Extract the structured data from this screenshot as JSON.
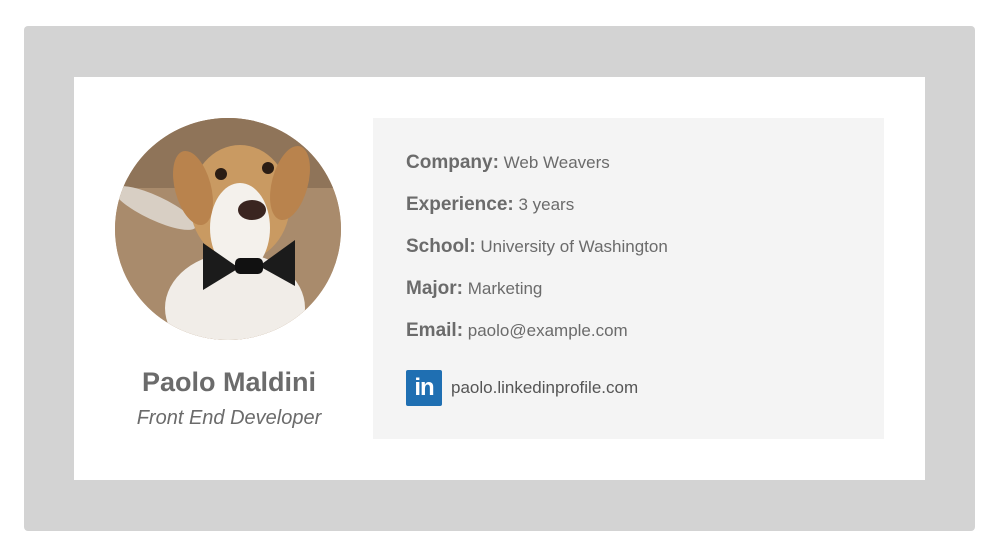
{
  "profile": {
    "name": "Paolo Maldini",
    "role": "Front End Developer"
  },
  "details": [
    {
      "label": "Company:",
      "value": "Web Weavers"
    },
    {
      "label": "Experience:",
      "value": "3 years"
    },
    {
      "label": "School:",
      "value": "University of Washington"
    },
    {
      "label": "Major:",
      "value": "Marketing"
    },
    {
      "label": "Email:",
      "value": "paolo@example.com"
    }
  ],
  "linkedin": {
    "icon_text": "in",
    "url": "paolo.linkedinprofile.com"
  },
  "colors": {
    "frame": "#d3d3d3",
    "panel": "#f4f4f4",
    "linkedin": "#1f6fb2",
    "text": "#6b6b6b"
  }
}
